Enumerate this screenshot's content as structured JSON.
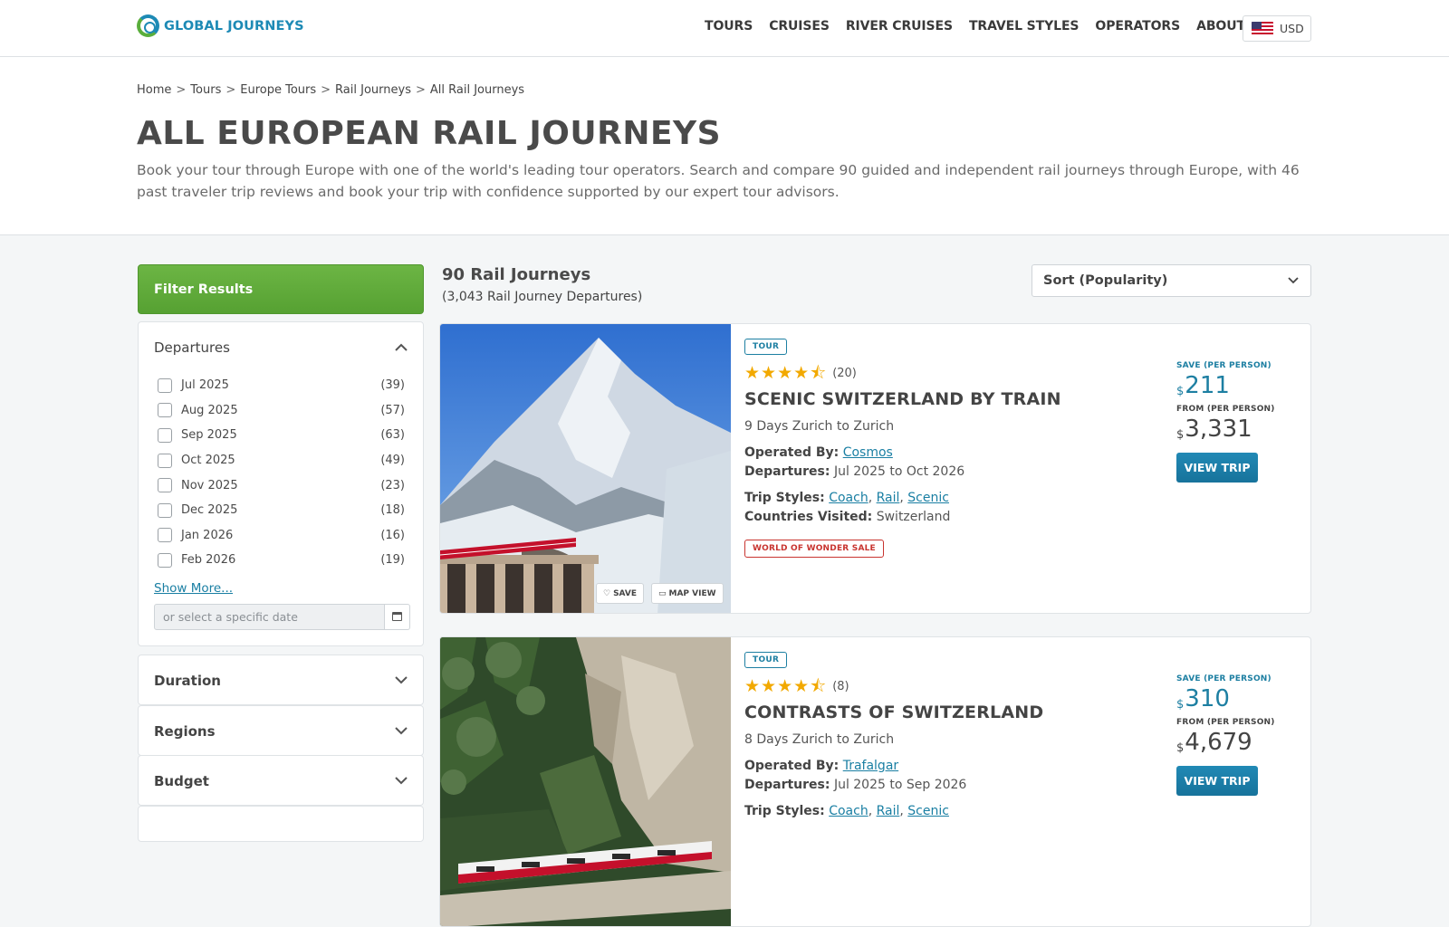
{
  "nav": {
    "logo_text": "GLOBAL JOURNEYS",
    "links": [
      "TOURS",
      "CRUISES",
      "RIVER CRUISES",
      "TRAVEL STYLES",
      "OPERATORS",
      "ABOUT"
    ],
    "currency": "USD"
  },
  "breadcrumb": [
    "Home",
    "Tours",
    "Europe Tours",
    "Rail Journeys",
    "All Rail Journeys"
  ],
  "header": {
    "title": "ALL EUROPEAN RAIL JOURNEYS",
    "description": "Book your tour through Europe with one of the world's leading tour operators. Search and compare 90 guided and independent rail journeys through Europe, with 46 past traveler trip reviews and book your trip with confidence supported by our expert tour advisors."
  },
  "sidebar": {
    "filter_button": "Filter Results",
    "departures": {
      "title": "Departures",
      "items": [
        {
          "label": "Jul 2025",
          "count": "(39)"
        },
        {
          "label": "Aug 2025",
          "count": "(57)"
        },
        {
          "label": "Sep 2025",
          "count": "(63)"
        },
        {
          "label": "Oct 2025",
          "count": "(49)"
        },
        {
          "label": "Nov 2025",
          "count": "(23)"
        },
        {
          "label": "Dec 2025",
          "count": "(18)"
        },
        {
          "label": "Jan 2026",
          "count": "(16)"
        },
        {
          "label": "Feb 2026",
          "count": "(19)"
        }
      ],
      "show_more": "Show More...",
      "date_placeholder": "or select a specific date"
    },
    "sections": [
      "Duration",
      "Regions",
      "Budget"
    ]
  },
  "results": {
    "count": "90 Rail Journeys",
    "departures": "(3,043 Rail Journey Departures)",
    "sort": "Sort (Popularity)"
  },
  "cards": [
    {
      "tag": "TOUR",
      "rating": 4.5,
      "review_count": "(20)",
      "title": "SCENIC SWITZERLAND BY TRAIN",
      "route": "9 Days Zurich to Zurich",
      "operated_label": "Operated By:",
      "operator": "Cosmos",
      "departures_label": "Departures:",
      "departures": "Jul 2025 to Oct 2026",
      "styles_label": "Trip Styles:",
      "styles": [
        "Coach",
        "Rail",
        "Scenic"
      ],
      "countries_label": "Countries Visited:",
      "countries": "Switzerland",
      "sale_tag": "WORLD OF WONDER SALE",
      "save_label": "SAVE (PER PERSON)",
      "currency_symbol": "$",
      "save_amount": "211",
      "from_label": "FROM (PER PERSON)",
      "from_amount": "3,331",
      "view_button": "VIEW TRIP",
      "img_save": "SAVE",
      "img_map": "MAP VIEW"
    },
    {
      "tag": "TOUR",
      "rating": 4.5,
      "review_count": "(8)",
      "title": "CONTRASTS OF SWITZERLAND",
      "route": "8 Days Zurich to Zurich",
      "operated_label": "Operated By:",
      "operator": "Trafalgar",
      "departures_label": "Departures:",
      "departures": "Jul 2025 to Sep 2026",
      "styles_label": "Trip Styles:",
      "styles": [
        "Coach",
        "Rail",
        "Scenic"
      ],
      "save_label": "SAVE (PER PERSON)",
      "currency_symbol": "$",
      "save_amount": "310",
      "from_label": "FROM (PER PERSON)",
      "from_amount": "4,679",
      "view_button": "VIEW TRIP"
    }
  ],
  "colors": {
    "brand_blue": "#1d8ab5",
    "brand_green": "#5aae3c",
    "sale_red": "#c8342f",
    "star": "#f2a900"
  }
}
